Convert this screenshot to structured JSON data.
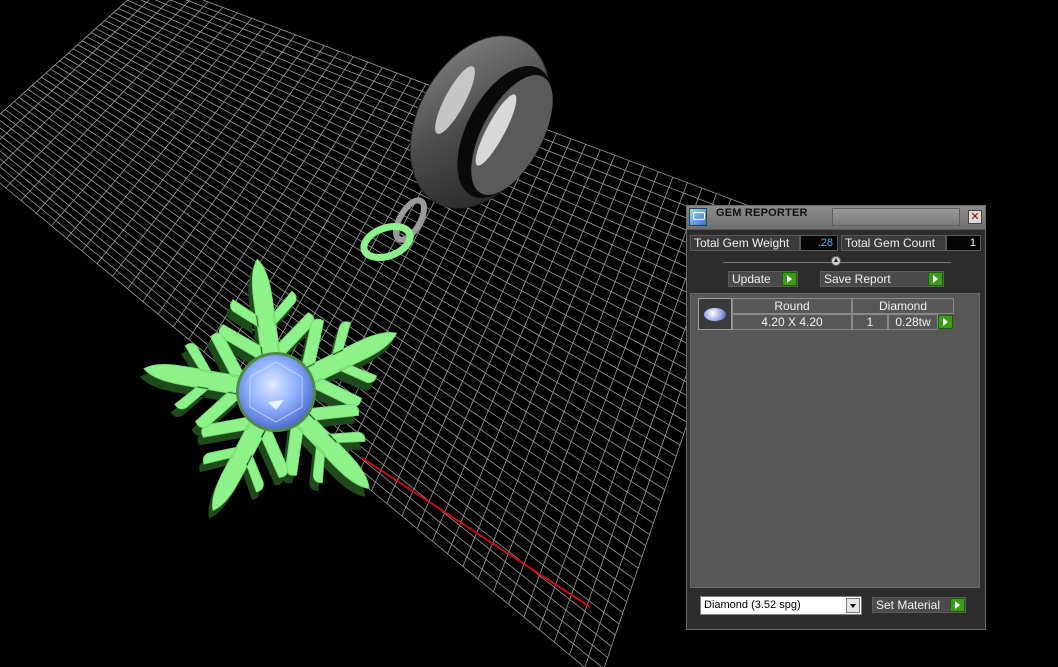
{
  "panel": {
    "title": "GEM REPORTER",
    "close_glyph": "✕",
    "total_gem_weight_label": "Total Gem Weight",
    "total_gem_weight_value": ".28",
    "total_gem_count_label": "Total Gem Count",
    "total_gem_count_value": "1",
    "update_label": "Update",
    "save_report_label": "Save Report",
    "gem_table": {
      "headers": [
        "Round",
        "Diamond"
      ],
      "row": {
        "size": "4.20 X 4.20",
        "qty": "1",
        "weight": "0.28tw"
      }
    },
    "material_select": "Diamond     (3.52 spg)",
    "set_material_label": "Set Material"
  },
  "colors": {
    "accent_green": "#3d9b1a",
    "weight_value_color": "#38b8ff",
    "count_value_color": "#ffffff",
    "charm_green": "#8ef28a",
    "gem_blue": "#7fa8ff"
  },
  "icons": {
    "app": "gem-reporter-app-icon",
    "gem": "round-gem-icon",
    "close": "close-icon",
    "play": "green-play-arrow-icon"
  }
}
